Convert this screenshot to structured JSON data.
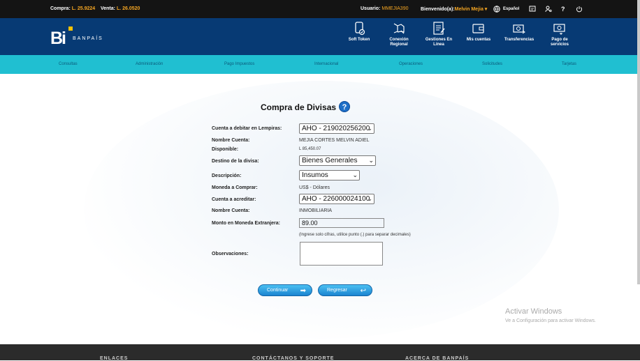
{
  "topbar": {
    "buy_label": "Compra:",
    "buy_value": "L. 25.9224",
    "sell_label": "Venta:",
    "sell_value": "L. 26.0520",
    "user_label": "Usuario:",
    "user_value": "MMEJIA390",
    "welcome_label": "Bienvenido(a):",
    "welcome_value": "Melvin Mejia",
    "language": "Español",
    "help_symbol": "?"
  },
  "brand": {
    "logo_mark": "Bi",
    "name": "BANPAÍS"
  },
  "header_nav": [
    {
      "label": "Soft Token",
      "icon": "phone-token-icon"
    },
    {
      "label": "Conexión Regional",
      "icon": "regional-icon"
    },
    {
      "label": "Gestiones En Línea",
      "icon": "online-forms-icon"
    },
    {
      "label": "Mis cuentas",
      "icon": "wallet-icon"
    },
    {
      "label": "Transferencias",
      "icon": "transfer-icon"
    },
    {
      "label": "Pago de servicios",
      "icon": "service-payment-icon"
    }
  ],
  "menu": [
    "Consultas",
    "Administración",
    "Pago Impuestos",
    "Internacional",
    "Operaciones",
    "Solicitudes",
    "Tarjetas"
  ],
  "form": {
    "title": "Compra de Divisas",
    "help_symbol": "?",
    "debit_label": "Cuenta a debitar en Lempiras:",
    "debit_value": "AHO - 219020256200",
    "name_label": "Nombre Cuenta:",
    "name_value": "MEJIA CORTES MELVIN ADIEL",
    "available_label": "Disponible:",
    "available_value": "L 85,450.07",
    "destination_label": "Destino de la divisa:",
    "destination_value": "Bienes Generales",
    "description_label": "Descripción:",
    "description_value": "Insumos",
    "currency_label": "Moneda a Comprar:",
    "currency_value": "US$ - Dólares",
    "credit_label": "Cuenta a acreditar:",
    "credit_value": "AHO - 226000024100",
    "credit_name_label": "Nombre Cuenta:",
    "credit_name_value": "INMOBILIARIA",
    "amount_label": "Monto en Moneda Extranjera:",
    "amount_value": "89.00",
    "amount_hint": "(Ingrese solo cifras, utilice punto (.) para separar decimales)",
    "notes_label": "Observaciones:",
    "continue_label": "Continuar",
    "back_label": "Regresar"
  },
  "windows": {
    "line1": "Activar Windows",
    "line2": "Ve a Configuración para activar Windows."
  },
  "footer": [
    "ENLACES",
    "CONTÁCTANOS Y SOPORTE",
    "ACERCA DE BANPAÍS"
  ]
}
